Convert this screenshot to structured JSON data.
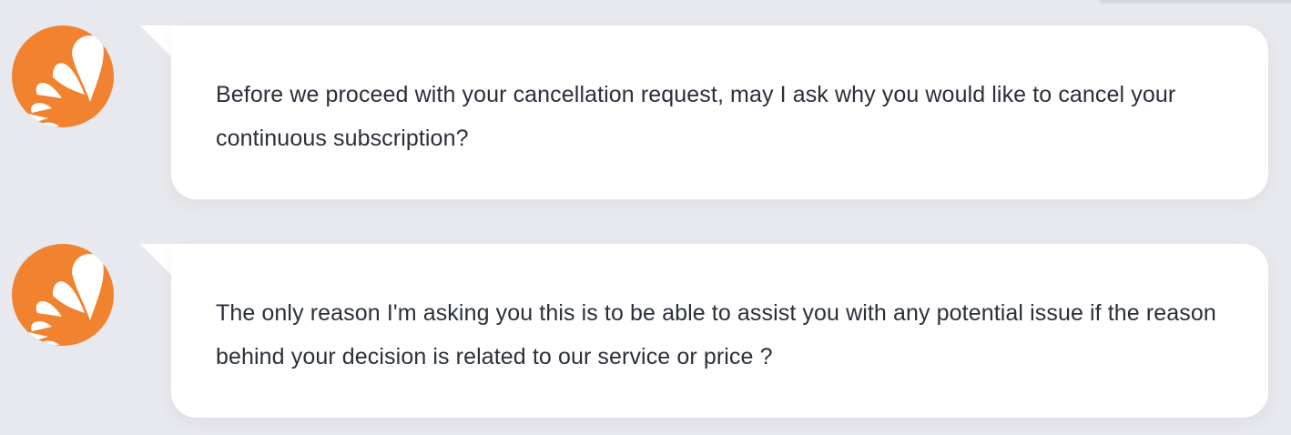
{
  "brand": {
    "accent_color": "#f08230",
    "avatar_icon": "sun-rays-logo-icon"
  },
  "messages": [
    {
      "sender": "agent",
      "text": "Before we proceed with your cancellation request, may I ask why you would like to cancel your continuous subscription?"
    },
    {
      "sender": "agent",
      "text": "The only reason I'm asking you this is to be able to assist you with any potential issue if the reason behind your decision is related to our service or price ?"
    }
  ]
}
